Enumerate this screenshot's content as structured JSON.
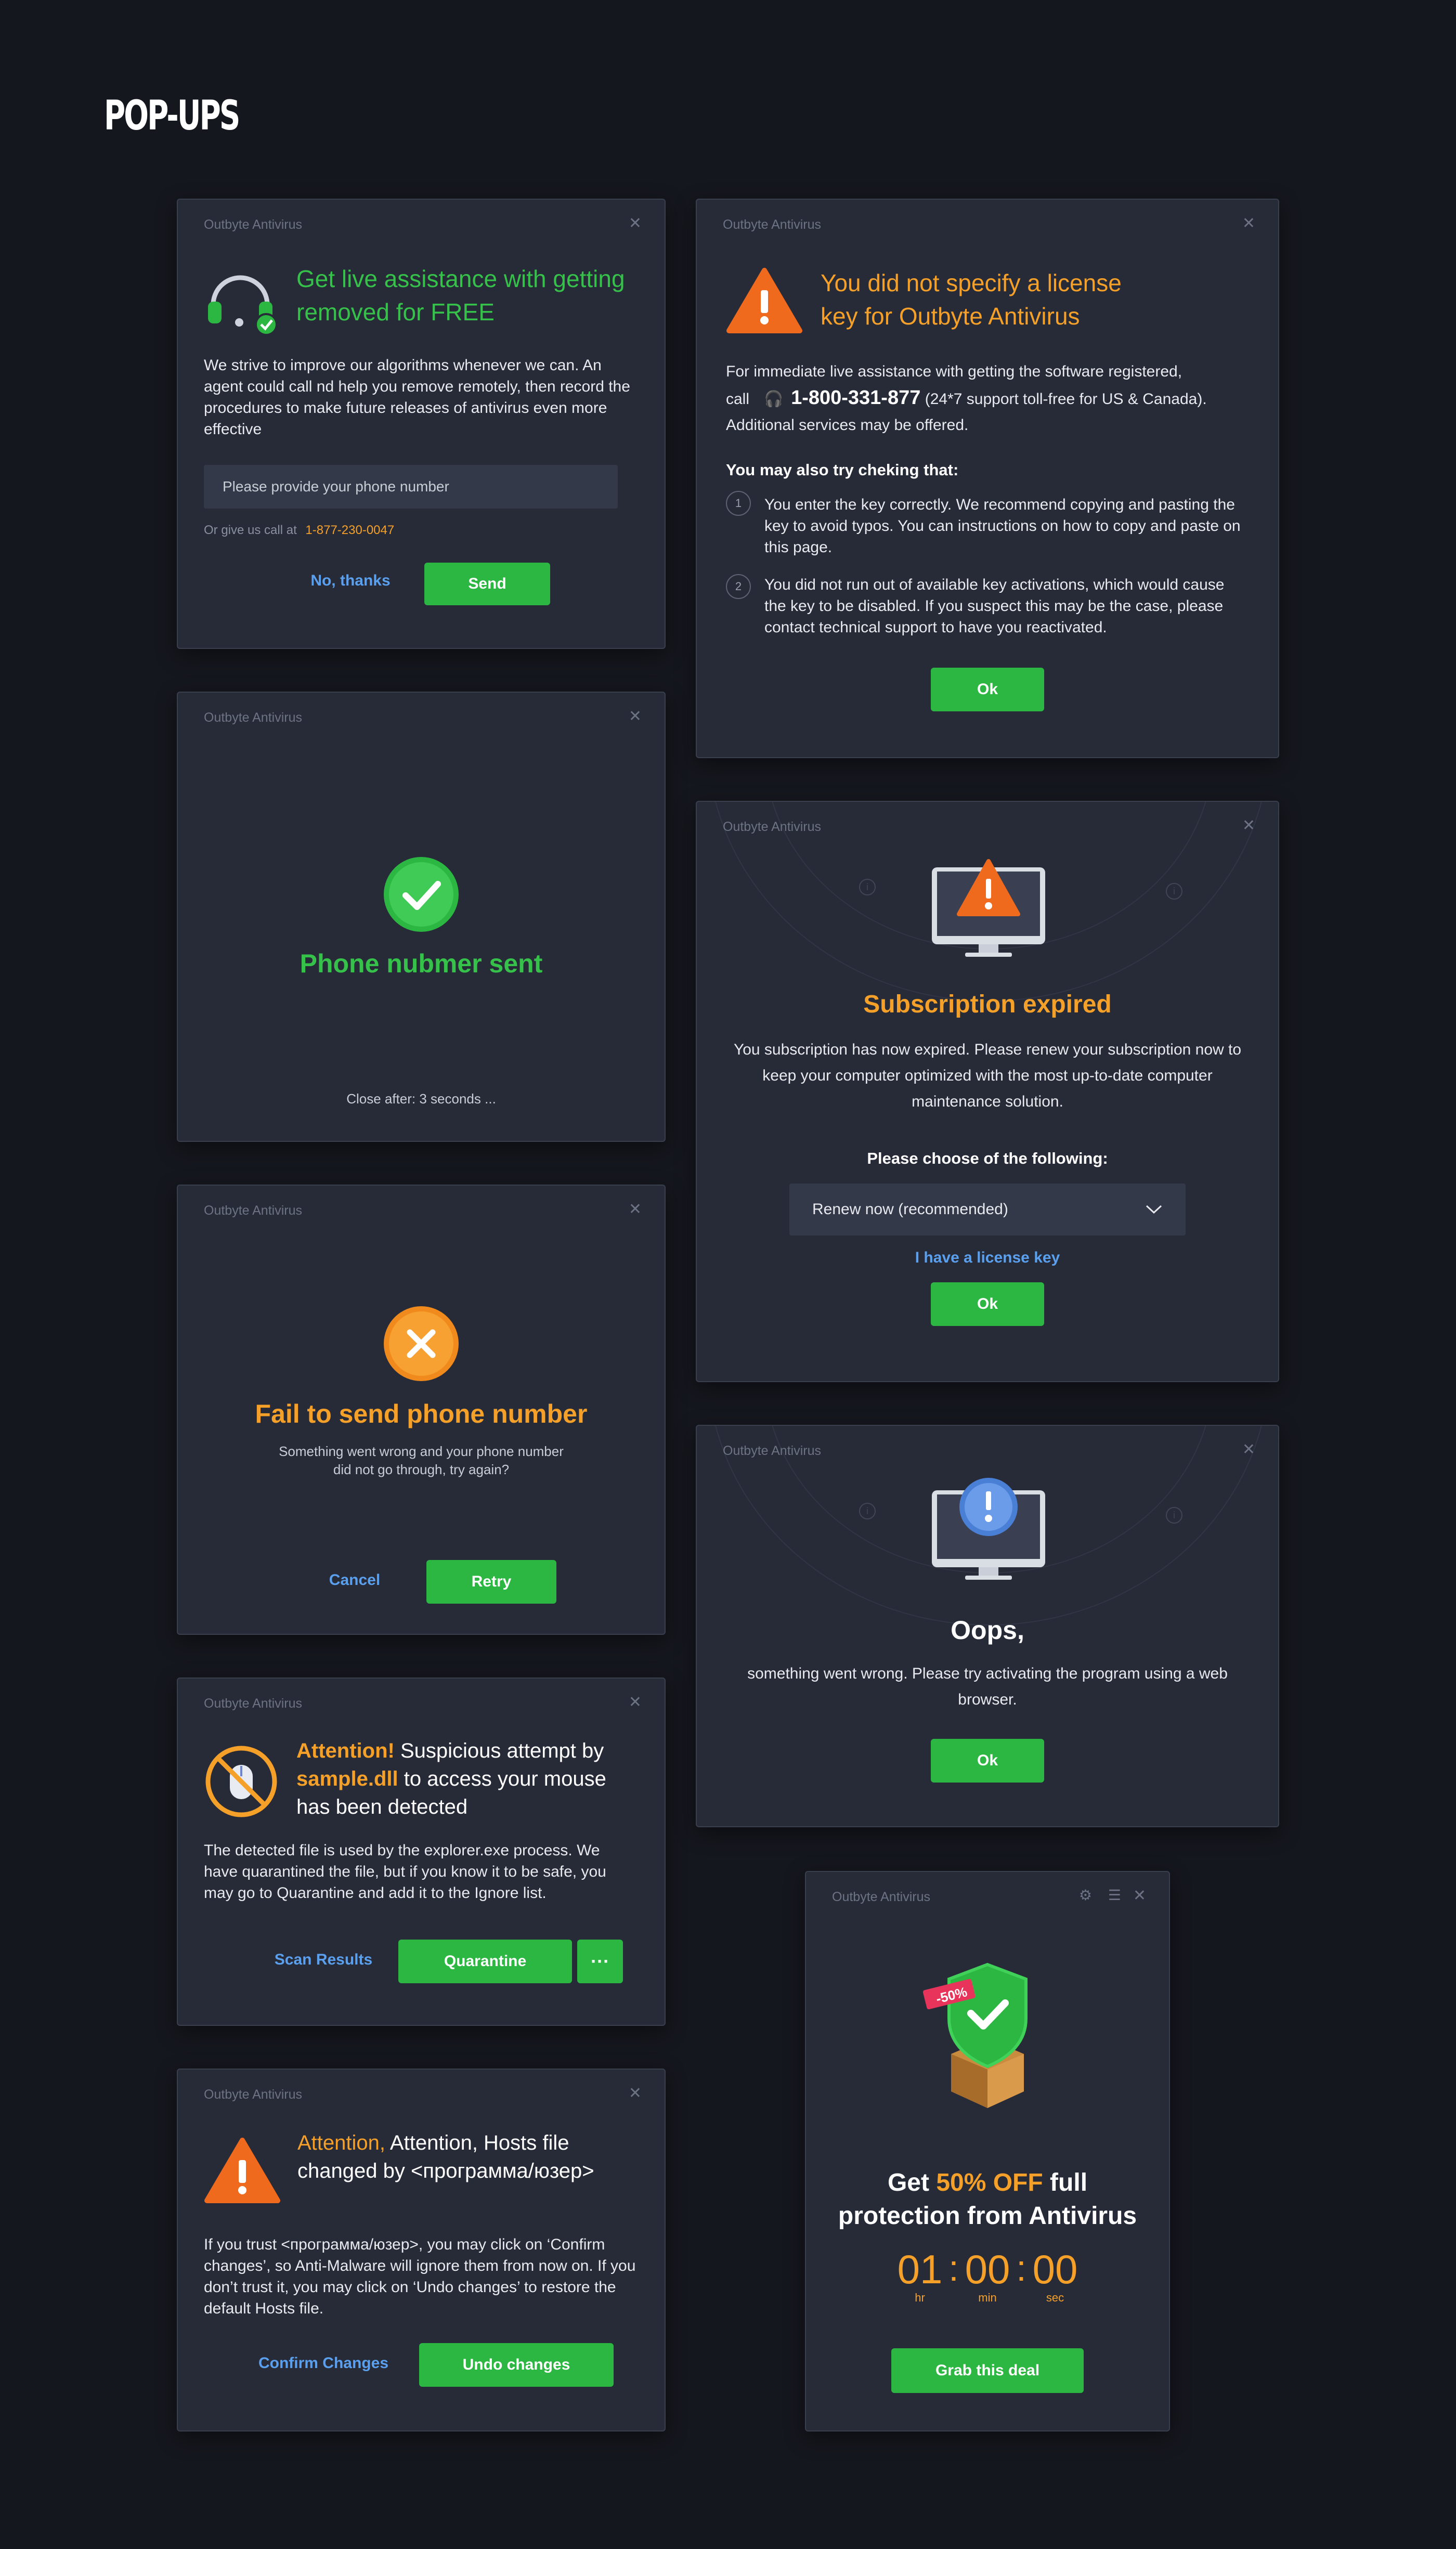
{
  "page_title": "POP-UPS",
  "app_name": "Outbyte Antivirus",
  "colors": {
    "green": "#2cb742",
    "orange": "#f5a029",
    "blue": "#5aa0ee",
    "background": "#15171e",
    "window": "#272b38"
  },
  "assistance": {
    "heading": "Get live assistance with getting removed for FREE",
    "body": "We strive to improve our algorithms whenever we can. An agent could call nd help you remove remotely, then record the procedures to make future releases of antivirus even more effective",
    "phone_placeholder": "Please provide your phone number",
    "call_prefix": "Or give us call at",
    "call_number": "1-877-230-0047",
    "no_thanks": "No, thanks",
    "send": "Send",
    "icon": "headset-check-icon"
  },
  "license": {
    "heading": "You did not specify a license key for Outbyte Antivirus",
    "intro_a": "For immediate live assistance with getting the software registered,",
    "intro_call": "call",
    "phone": "1-800-331-877",
    "intro_b": "(24*7 support toll-free for US & Canada).",
    "intro_c": "Additional services may be offered.",
    "subheading": "You may also try cheking that:",
    "items": [
      {
        "num": "1",
        "text": "You enter the key correctly. We recommend copying and pasting the key to avoid typos. You can instructions on how to copy and paste on this page."
      },
      {
        "num": "2",
        "text": "You did not run out of available key activations, which would cause the key to be disabled. If you suspect this may be the case, please contact technical support to have you reactivated."
      }
    ],
    "ok": "Ok",
    "icon": "warning-icon"
  },
  "phone_sent": {
    "heading": "Phone nubmer sent",
    "countdown": "Close after: 3 seconds ...",
    "icon": "check-circle-icon"
  },
  "subscription": {
    "heading": "Subscription expired",
    "body": "You subscription has now expired. Please renew your subscription now to keep your computer optimized with the most up-to-date computer maintenance solution.",
    "choose_label": "Please choose of the following:",
    "select_value": "Renew now (recommended)",
    "license_link": "I have a license key",
    "ok": "Ok",
    "icon": "monitor-warning-icon"
  },
  "fail": {
    "heading": "Fail to send phone number",
    "body": "Something went wrong and your phone number did not go through, try again?",
    "cancel": "Cancel",
    "retry": "Retry",
    "icon": "x-circle-icon"
  },
  "oops": {
    "heading": "Oops,",
    "body": "something went wrong. Please try activating the program using a web browser.",
    "ok": "Ok",
    "icon": "monitor-info-icon"
  },
  "mouse": {
    "attention": "Attention!",
    "heading_a": "Suspicious attempt by",
    "file": "sample.dll",
    "heading_b": "to access your mouse has been detected",
    "body": "The detected file is used by the explorer.exe process. We have quarantined the file, but if you know it to be safe, you may go to Quarantine and add it to the Ignore list.",
    "scan_results": "Scan Results",
    "quarantine": "Quarantine",
    "more": "···",
    "icon": "blocked-mouse-icon"
  },
  "deal": {
    "discount_tag": "-50%",
    "heading_a": "Get",
    "heading_pct": "50% OFF",
    "heading_b": "full protection from Antivirus",
    "timer": [
      {
        "value": "01",
        "unit": "hr"
      },
      {
        "value": "00",
        "unit": "min"
      },
      {
        "value": "00",
        "unit": "sec"
      }
    ],
    "cta": "Grab this deal",
    "icon": "shield-box-icon"
  },
  "hosts": {
    "attention": "Attention,",
    "heading": "Attention, Hosts file changed by <программа/юзер>",
    "body": "If you trust <программа/юзер>, you may click on ‘Confirm changes’, so Anti-Malware will ignore them from now on. If you don’t trust it, you may click on ‘Undo changes’ to restore the default Hosts file.",
    "confirm": "Confirm Changes",
    "undo": "Undo changes",
    "icon": "warning-icon"
  }
}
